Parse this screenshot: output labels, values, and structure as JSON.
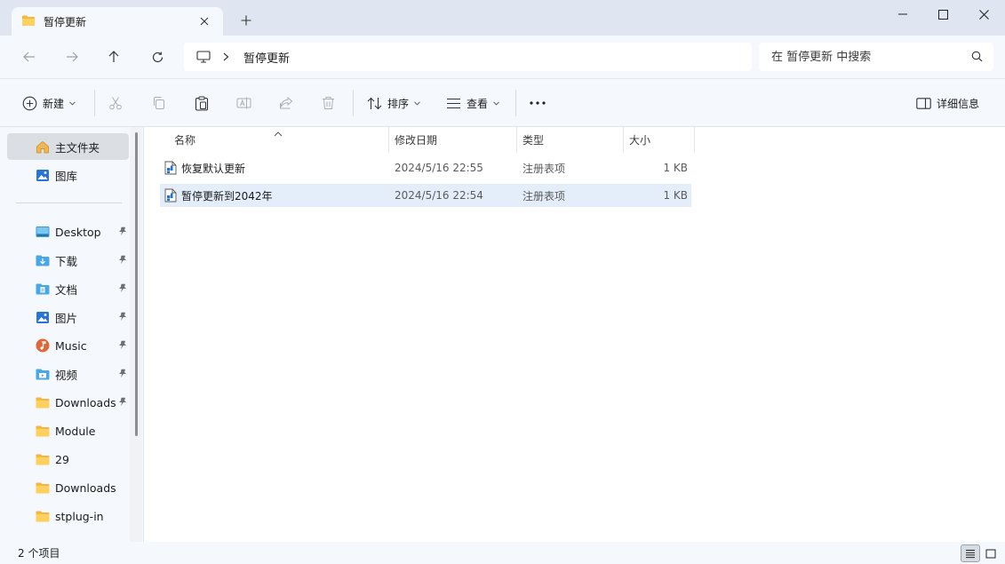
{
  "tab": {
    "title": "暂停更新"
  },
  "address": {
    "path_label": "暂停更新"
  },
  "search": {
    "placeholder": "在 暂停更新 中搜索"
  },
  "toolbar": {
    "new_label": "新建",
    "sort_label": "排序",
    "view_label": "查看",
    "details_label": "详细信息"
  },
  "sidebar": {
    "top_items": [
      {
        "label": "主文件夹",
        "icon": "home-icon"
      },
      {
        "label": "图库",
        "icon": "gallery-icon"
      }
    ],
    "items": [
      {
        "label": "Desktop",
        "icon": "desktop-icon",
        "pinned": true
      },
      {
        "label": "下载",
        "icon": "download-icon",
        "pinned": true
      },
      {
        "label": "文档",
        "icon": "document-icon",
        "pinned": true
      },
      {
        "label": "图片",
        "icon": "pictures-icon",
        "pinned": true
      },
      {
        "label": "Music",
        "icon": "music-icon",
        "pinned": true
      },
      {
        "label": "视频",
        "icon": "video-icon",
        "pinned": true
      },
      {
        "label": "Downloads",
        "icon": "folder-icon",
        "pinned": true
      },
      {
        "label": "Module",
        "icon": "folder-icon",
        "pinned": false
      },
      {
        "label": "29",
        "icon": "folder-icon",
        "pinned": false
      },
      {
        "label": "Downloads",
        "icon": "folder-icon",
        "pinned": false
      },
      {
        "label": "stplug-in",
        "icon": "folder-icon",
        "pinned": false
      }
    ]
  },
  "table": {
    "columns": [
      "名称",
      "修改日期",
      "类型",
      "大小"
    ],
    "rows": [
      {
        "name": "恢复默认更新",
        "date": "2024/5/16 22:55",
        "type": "注册表项",
        "size": "1 KB",
        "selected": false
      },
      {
        "name": "暂停更新到2042年",
        "date": "2024/5/16 22:54",
        "type": "注册表项",
        "size": "1 KB",
        "selected": true
      }
    ]
  },
  "status": {
    "item_count": "2 个项目"
  },
  "colors": {
    "accent": "#0067c0",
    "selection": "#e4eefb",
    "folder": "#f8c43c"
  }
}
